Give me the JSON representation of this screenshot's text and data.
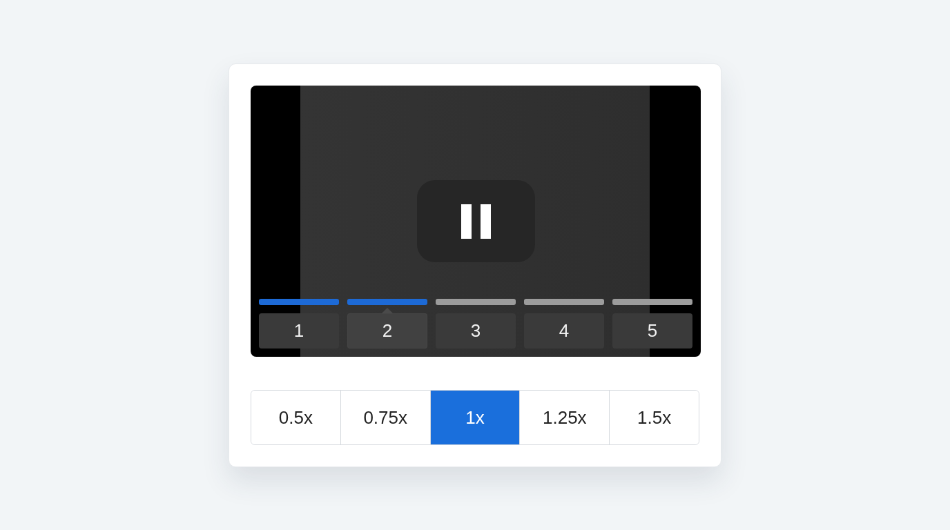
{
  "player": {
    "playing": true
  },
  "chapters": [
    {
      "label": "1",
      "watched": true,
      "selected": false
    },
    {
      "label": "2",
      "watched": true,
      "selected": true
    },
    {
      "label": "3",
      "watched": false,
      "selected": false
    },
    {
      "label": "4",
      "watched": false,
      "selected": false
    },
    {
      "label": "5",
      "watched": false,
      "selected": false
    }
  ],
  "speeds": [
    {
      "label": "0.5x",
      "selected": false
    },
    {
      "label": "0.75x",
      "selected": false
    },
    {
      "label": "1x",
      "selected": true
    },
    {
      "label": "1.25x",
      "selected": false
    },
    {
      "label": "1.5x",
      "selected": false
    }
  ]
}
